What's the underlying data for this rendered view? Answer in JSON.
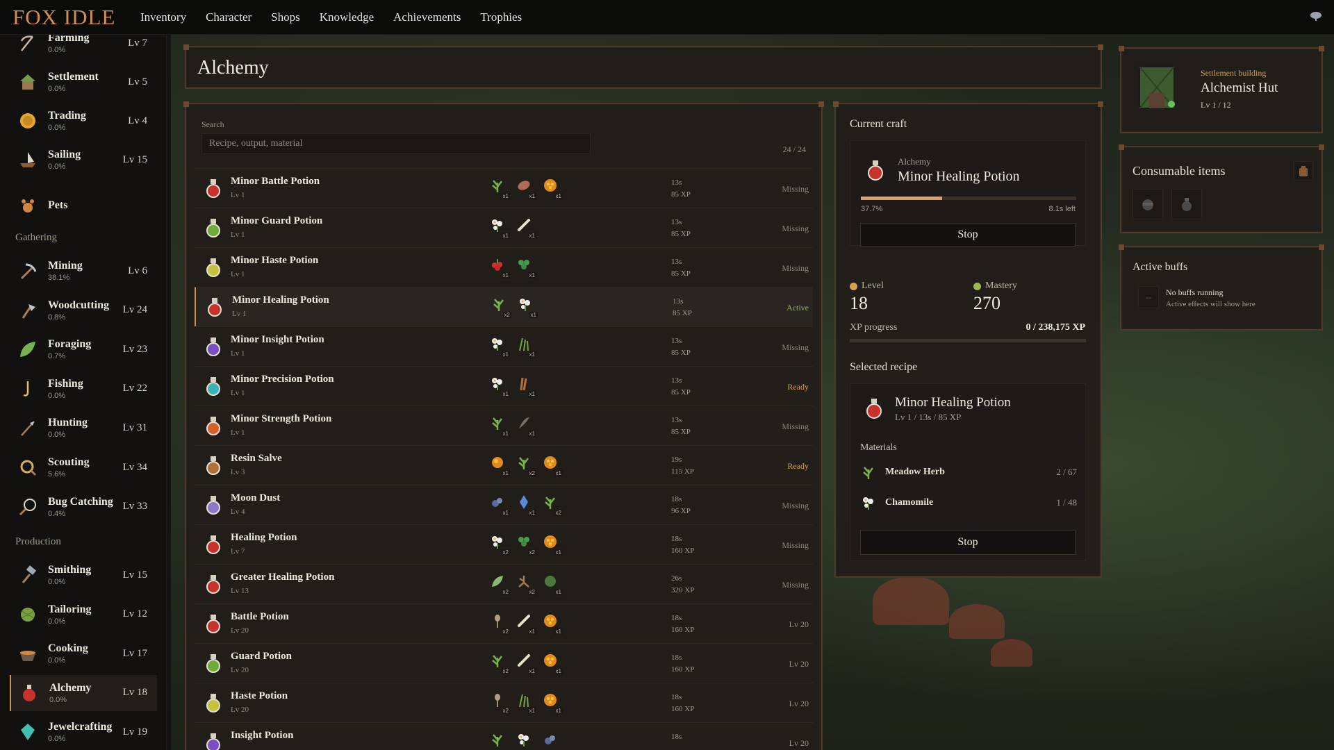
{
  "app": {
    "title": "FOX IDLE"
  },
  "nav": [
    "Inventory",
    "Character",
    "Shops",
    "Knowledge",
    "Achievements",
    "Trophies"
  ],
  "sidebar": {
    "top_items": [
      {
        "name": "Farming",
        "pct": "0.0%",
        "lv": "Lv 7",
        "icon": "scythe-icon"
      },
      {
        "name": "Settlement",
        "pct": "0.0%",
        "lv": "Lv 5",
        "icon": "house-icon"
      },
      {
        "name": "Trading",
        "pct": "0.0%",
        "lv": "Lv 4",
        "icon": "coin-icon"
      },
      {
        "name": "Sailing",
        "pct": "0.0%",
        "lv": "Lv 15",
        "icon": "ship-icon"
      },
      {
        "name": "Pets",
        "pct": "",
        "lv": "",
        "icon": "paw-icon"
      }
    ],
    "gathering_label": "Gathering",
    "gathering": [
      {
        "name": "Mining",
        "pct": "38.1%",
        "lv": "Lv 6",
        "icon": "pickaxe-icon"
      },
      {
        "name": "Woodcutting",
        "pct": "0.8%",
        "lv": "Lv 24",
        "icon": "axe-icon"
      },
      {
        "name": "Foraging",
        "pct": "0.7%",
        "lv": "Lv 23",
        "icon": "leaf-icon"
      },
      {
        "name": "Fishing",
        "pct": "0.0%",
        "lv": "Lv 22",
        "icon": "hook-icon"
      },
      {
        "name": "Hunting",
        "pct": "0.0%",
        "lv": "Lv 31",
        "icon": "spear-icon"
      },
      {
        "name": "Scouting",
        "pct": "5.6%",
        "lv": "Lv 34",
        "icon": "spyglass-icon"
      },
      {
        "name": "Bug Catching",
        "pct": "0.4%",
        "lv": "Lv 33",
        "icon": "net-icon"
      }
    ],
    "production_label": "Production",
    "production": [
      {
        "name": "Smithing",
        "pct": "0.0%",
        "lv": "Lv 15",
        "icon": "hammer-icon"
      },
      {
        "name": "Tailoring",
        "pct": "0.0%",
        "lv": "Lv 12",
        "icon": "yarn-icon"
      },
      {
        "name": "Cooking",
        "pct": "0.0%",
        "lv": "Lv 17",
        "icon": "pot-icon"
      },
      {
        "name": "Alchemy",
        "pct": "0.0%",
        "lv": "Lv 18",
        "icon": "flask-icon"
      },
      {
        "name": "Jewelcrafting",
        "pct": "0.0%",
        "lv": "Lv 19",
        "icon": "gem-icon"
      }
    ]
  },
  "page": {
    "title": "Alchemy"
  },
  "search": {
    "label": "Search",
    "placeholder": "Recipe, output, material",
    "count": "24 / 24"
  },
  "recipes": [
    {
      "name": "Minor Battle Potion",
      "lv": "Lv 1",
      "time": "13s",
      "xp": "85 XP",
      "status": "Missing",
      "color": "#c8322c",
      "mats": [
        [
          "herb-icon",
          "x1"
        ],
        [
          "meat-icon",
          "x1"
        ],
        [
          "honeycomb-icon",
          "x1"
        ]
      ]
    },
    {
      "name": "Minor Guard Potion",
      "lv": "Lv 1",
      "time": "13s",
      "xp": "85 XP",
      "status": "Missing",
      "color": "#6faa3a",
      "mats": [
        [
          "flower-icon",
          "x1"
        ],
        [
          "bone-icon",
          "x1"
        ]
      ]
    },
    {
      "name": "Minor Haste Potion",
      "lv": "Lv 1",
      "time": "13s",
      "xp": "85 XP",
      "status": "Missing",
      "color": "#c4c23a",
      "mats": [
        [
          "berry-icon",
          "x1"
        ],
        [
          "clover-icon",
          "x1"
        ]
      ]
    },
    {
      "name": "Minor Healing Potion",
      "lv": "Lv 1",
      "time": "13s",
      "xp": "85 XP",
      "status": "Active",
      "color": "#c8322c",
      "mats": [
        [
          "herb-icon",
          "x2"
        ],
        [
          "flower-icon",
          "x1"
        ]
      ]
    },
    {
      "name": "Minor Insight Potion",
      "lv": "Lv 1",
      "time": "13s",
      "xp": "85 XP",
      "status": "Missing",
      "color": "#7a4ec0",
      "mats": [
        [
          "flower-icon",
          "x1"
        ],
        [
          "grass-icon",
          "x1"
        ]
      ]
    },
    {
      "name": "Minor Precision Potion",
      "lv": "Lv 1",
      "time": "13s",
      "xp": "85 XP",
      "status": "Ready",
      "color": "#3ab0b8",
      "mats": [
        [
          "flower-icon",
          "x1"
        ],
        [
          "twig-icon",
          "x1"
        ]
      ]
    },
    {
      "name": "Minor Strength Potion",
      "lv": "Lv 1",
      "time": "13s",
      "xp": "85 XP",
      "status": "Missing",
      "color": "#d8602a",
      "mats": [
        [
          "herb-icon",
          "x1"
        ],
        [
          "feather-icon",
          "x1"
        ]
      ]
    },
    {
      "name": "Resin Salve",
      "lv": "Lv 3",
      "time": "19s",
      "xp": "115 XP",
      "status": "Ready",
      "color": "#b0703a",
      "mats": [
        [
          "resin-icon",
          "x1"
        ],
        [
          "herb-icon",
          "x2"
        ],
        [
          "honeycomb-icon",
          "x1"
        ]
      ]
    },
    {
      "name": "Moon Dust",
      "lv": "Lv 4",
      "time": "18s",
      "xp": "96 XP",
      "status": "Missing",
      "color": "#8a78c8",
      "mats": [
        [
          "pebble-icon",
          "x1"
        ],
        [
          "crystal-icon",
          "x1"
        ],
        [
          "herb-icon",
          "x2"
        ]
      ]
    },
    {
      "name": "Healing Potion",
      "lv": "Lv 7",
      "time": "18s",
      "xp": "160 XP",
      "status": "Missing",
      "color": "#c8322c",
      "mats": [
        [
          "flower-icon",
          "x2"
        ],
        [
          "clover-icon",
          "x2"
        ],
        [
          "honeycomb-icon",
          "x1"
        ]
      ]
    },
    {
      "name": "Greater Healing Potion",
      "lv": "Lv 13",
      "time": "26s",
      "xp": "320 XP",
      "status": "Missing",
      "color": "#c8322c",
      "mats": [
        [
          "leaf-icon",
          "x2"
        ],
        [
          "root-icon",
          "x2"
        ],
        [
          "shrub-icon",
          "x1"
        ]
      ]
    },
    {
      "name": "Battle Potion",
      "lv": "Lv 20",
      "time": "18s",
      "xp": "160 XP",
      "status": "Lv 20",
      "color": "#c8322c",
      "mats": [
        [
          "sprout-icon",
          "x2"
        ],
        [
          "bone-icon",
          "x1"
        ],
        [
          "honeycomb-icon",
          "x1"
        ]
      ]
    },
    {
      "name": "Guard Potion",
      "lv": "Lv 20",
      "time": "18s",
      "xp": "160 XP",
      "status": "Lv 20",
      "color": "#6faa3a",
      "mats": [
        [
          "herb-icon",
          "x2"
        ],
        [
          "bone-icon",
          "x1"
        ],
        [
          "honeycomb-icon",
          "x1"
        ]
      ]
    },
    {
      "name": "Haste Potion",
      "lv": "Lv 20",
      "time": "18s",
      "xp": "160 XP",
      "status": "Lv 20",
      "color": "#c4c23a",
      "mats": [
        [
          "sprout-icon",
          "x2"
        ],
        [
          "grass-icon",
          "x1"
        ],
        [
          "honeycomb-icon",
          "x1"
        ]
      ]
    },
    {
      "name": "Insight Potion",
      "lv": "",
      "time": "18s",
      "xp": "",
      "status": "Lv 20",
      "color": "#7a4ec0",
      "mats": [
        [
          "herb-icon",
          ""
        ],
        [
          "flower-icon",
          ""
        ],
        [
          "pebble-icon",
          ""
        ]
      ]
    }
  ],
  "current_craft": {
    "heading": "Current craft",
    "category": "Alchemy",
    "name": "Minor Healing Potion",
    "progress_fraction": 0.377,
    "progress_pct": "37.7%",
    "time_left": "8.1s left",
    "stop_label": "Stop"
  },
  "stats": {
    "level_label": "Level",
    "level": "18",
    "mastery_label": "Mastery",
    "mastery": "270",
    "xp_label": "XP progress",
    "xp_value": "0 / 238,175 XP",
    "xp_fraction": 0
  },
  "selected_recipe": {
    "heading": "Selected recipe",
    "name": "Minor Healing Potion",
    "meta": "Lv 1 / 13s / 85 XP",
    "materials_label": "Materials",
    "materials": [
      {
        "name": "Meadow Herb",
        "have": "2 / 67",
        "icon": "herb-icon"
      },
      {
        "name": "Chamomile",
        "have": "1 / 48",
        "icon": "flower-icon"
      }
    ],
    "stop_label": "Stop"
  },
  "building": {
    "label": "Settlement building",
    "name": "Alchemist Hut",
    "lv": "Lv 1 / 12"
  },
  "consumables": {
    "heading": "Consumable items"
  },
  "buffs": {
    "heading": "Active buffs",
    "slot": "--",
    "empty_title": "No buffs running",
    "empty_sub": "Active effects will show here"
  },
  "colors": {
    "accent": "#c99057",
    "logo": "#d28d52",
    "progress": "#dba06a",
    "ready": "#d8a24a",
    "active": "#8db466"
  }
}
